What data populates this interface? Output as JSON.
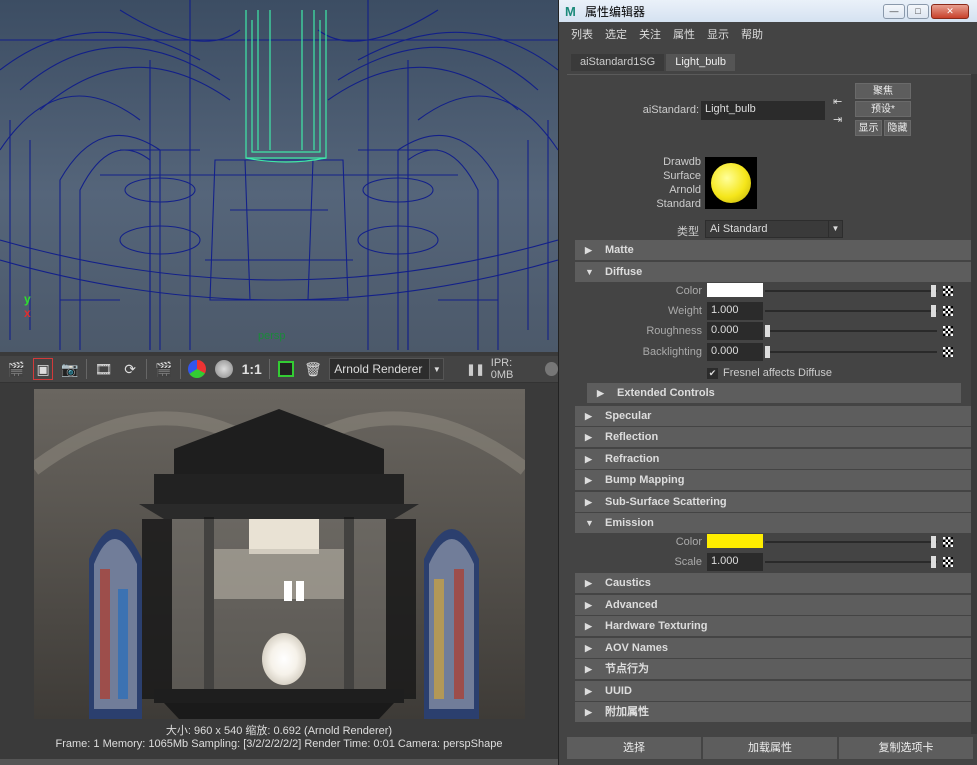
{
  "viewport": {
    "camera_label": "persp",
    "axis": {
      "y": "y",
      "x": "x"
    }
  },
  "render_toolbar": {
    "ratio": "1:1",
    "renderer": "Arnold Renderer",
    "ipr": "IPR: 0MB",
    "icons": [
      "render-icon",
      "render-region-icon",
      "snapshot-icon",
      "ipr-render-icon",
      "refresh-icon",
      "render-sequence-icon",
      "rgb-channel-icon",
      "alpha-channel-icon",
      "real-size-icon",
      "keep-image-icon",
      "remove-image-icon",
      "pause-icon"
    ]
  },
  "render_info": {
    "line1": "大小: 960 x 540 缩放: 0.692    (Arnold Renderer)",
    "line2": "Frame: 1    Memory: 1065Mb    Sampling: [3/2/2/2/2/2]    Render Time: 0:01    Camera: perspShape"
  },
  "attribute_editor": {
    "title": "属性编辑器",
    "window_buttons": {
      "minimize": "—",
      "maximize": "□",
      "close": "✕"
    },
    "menu": [
      "列表",
      "选定",
      "关注",
      "属性",
      "显示",
      "帮助"
    ],
    "tabs": [
      "aiStandard1SG",
      "Light_bulb"
    ],
    "node_label": "aiStandard:",
    "node_name": "Light_bulb",
    "buttons": {
      "focus": "聚焦",
      "presets": "预设*",
      "show": "显示",
      "hide": "隐藏"
    },
    "swatch_label": "Drawdb Surface Arnold Standard",
    "swatch_lines": [
      "Drawdb",
      "Surface",
      "Arnold",
      "Standard"
    ],
    "swatch_color": "#f5e61a",
    "type_label": "类型",
    "type_value": "Ai Standard",
    "sections": {
      "matte": "Matte",
      "diffuse": "Diffuse",
      "extended": "Extended Controls",
      "specular": "Specular",
      "reflection": "Reflection",
      "refraction": "Refraction",
      "bump": "Bump Mapping",
      "sss": "Sub-Surface Scattering",
      "emission": "Emission",
      "caustics": "Caustics",
      "advanced": "Advanced",
      "hw_texturing": "Hardware Texturing",
      "aov": "AOV Names",
      "node_behavior": "节点行为",
      "uuid": "UUID",
      "extra_attrs": "附加属性"
    },
    "diffuse": {
      "color_label": "Color",
      "color_value": "#ffffff",
      "weight_label": "Weight",
      "weight_value": "1.000",
      "roughness_label": "Roughness",
      "roughness_value": "0.000",
      "backlighting_label": "Backlighting",
      "backlighting_value": "0.000",
      "fresnel_label": "Fresnel affects Diffuse",
      "fresnel_checked": true
    },
    "emission": {
      "color_label": "Color",
      "color_value": "#ffee00",
      "scale_label": "Scale",
      "scale_value": "1.000"
    },
    "footer": [
      "选择",
      "加载属性",
      "复制选项卡"
    ]
  }
}
